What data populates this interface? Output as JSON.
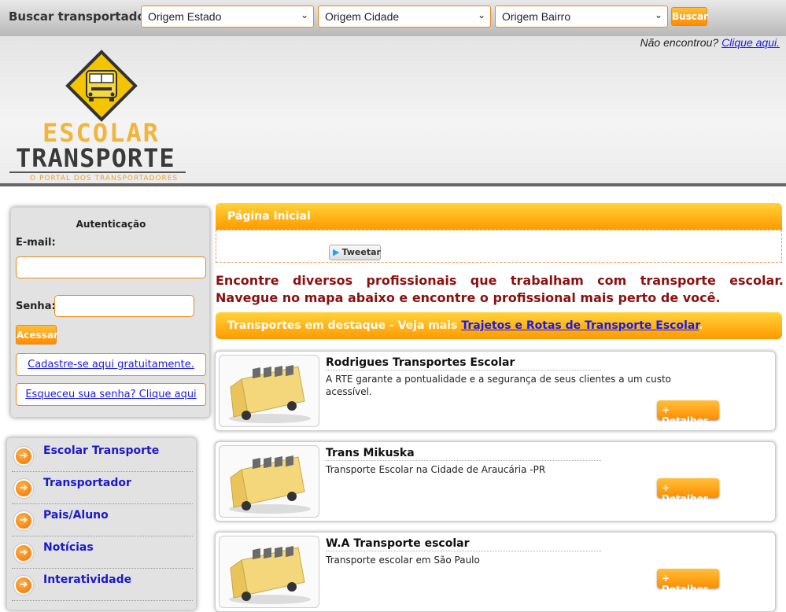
{
  "search": {
    "label": "Buscar transportador:",
    "estado": "Origem Estado",
    "cidade": "Origem Cidade",
    "bairro": "Origem Bairro",
    "button": "Buscar"
  },
  "header": {
    "not_found": "Não encontrou?",
    "click_here": "Clique aqui.",
    "logo_word1": "ESCOLAR",
    "logo_word2": "TRANSPORTE",
    "logo_subtitle": "O PORTAL DOS TRANSPORTADORES"
  },
  "auth": {
    "title": "Autenticação",
    "email_label": "E-mail:",
    "password_label": "Senha:",
    "login_button": "Acessar",
    "register_link": "Cadastre-se aqui gratuitamente.",
    "forgot_link": "Esqueceu sua senha? Clique aqui"
  },
  "menu": {
    "items": [
      {
        "label": "Escolar Transporte"
      },
      {
        "label": "Transportador"
      },
      {
        "label": "Pais/Aluno"
      },
      {
        "label": "Notícias"
      },
      {
        "label": "Interatividade"
      }
    ]
  },
  "main": {
    "home_title": "Página Inicial",
    "tweet": "Tweetar",
    "intro": "Encontre diversos profissionais que trabalham com transporte escolar. Navegue no mapa abaixo e encontre o profissional mais perto de você.",
    "featured_prefix": "Transportes em destaque - Veja mais",
    "featured_link": "Trajetos e Rotas de Transporte Escolar",
    "featured_suffix": ".",
    "details_label": "+ Detalhes",
    "cards": [
      {
        "name": "Rodrigues Transportes Escolar",
        "desc": "A RTE garante a pontualidade e a segurança de seus clientes a um custo acessível."
      },
      {
        "name": "Trans Mikuska",
        "desc": "Transporte Escolar na Cidade de Araucária -PR"
      },
      {
        "name": "W.A Transporte escolar",
        "desc": "Transporte escolar em São Paulo"
      }
    ]
  },
  "colors": {
    "accent_orange": "#ff9a00",
    "link_blue": "#1a1aee",
    "intro_red": "#8b1010"
  }
}
